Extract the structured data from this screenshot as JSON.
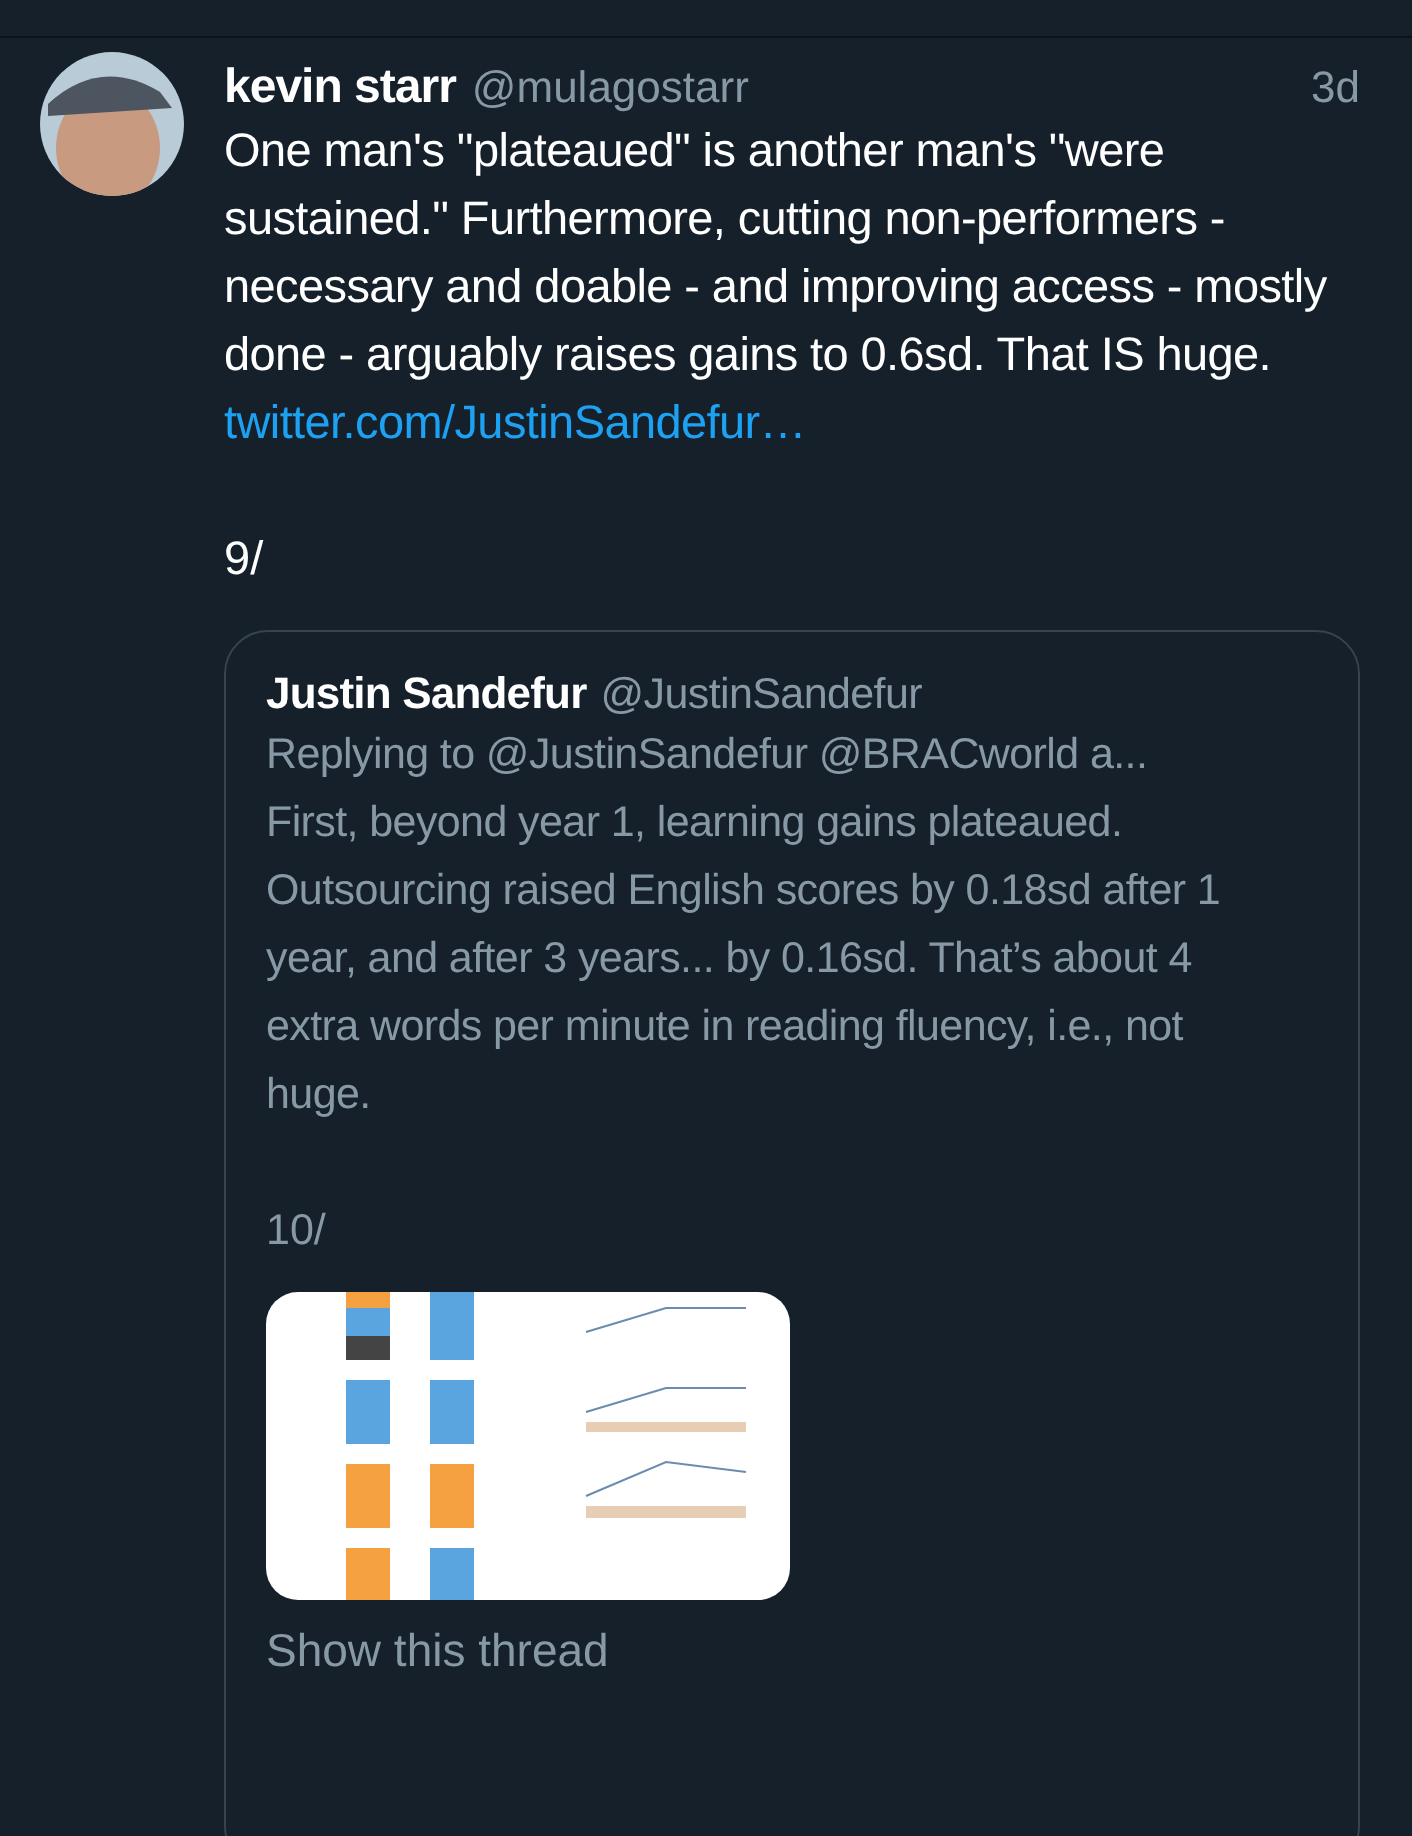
{
  "tweet": {
    "name": "kevin starr",
    "handle": "@mulagostarr",
    "time": "3d",
    "text": "One man's \"plateaued\" is another man's \"were sustained.\" Furthermore, cutting non-performers - necessary and doable - and improving access - mostly done - arguably raises gains to 0.6sd.  That IS huge.",
    "link": "twitter.com/JustinSandefur…",
    "thread_mark": "9/",
    "quoted": {
      "name": "Justin Sandefur",
      "handle": "@JustinSandefur",
      "replying_to": "Replying to @JustinSandefur @BRACworld a...",
      "text": "First, beyond year 1, learning gains plateaued. Outsourcing raised English scores by 0.18sd after 1 year, and after 3 years... by 0.16sd. That’s about 4 extra words per minute in reading fluency, i.e., not huge.",
      "thread_mark": "10/",
      "show_thread": "Show this thread"
    }
  }
}
